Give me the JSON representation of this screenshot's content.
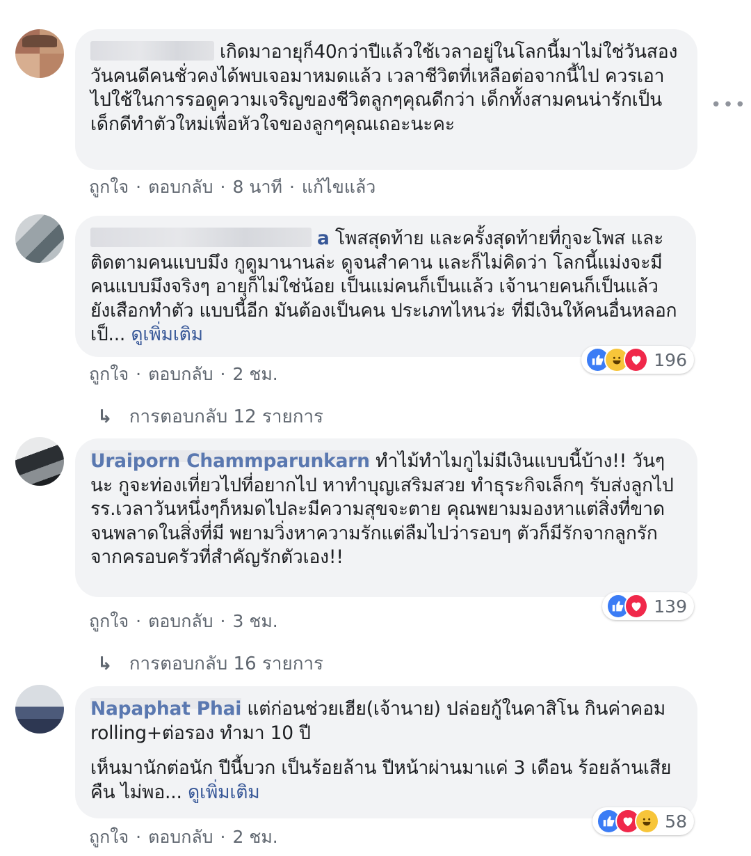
{
  "comments": [
    {
      "name_visible": "",
      "text": "เกิดมาอายุก็40กว่าปีแล้วใช้เวลาอยู่ในโลกนี้มาไม่ใช่วันสองวันคนดีคนชั่วคงได้พบเจอมาหมดแล้ว เวลาชีวิตที่เหลือต่อจากนี้ไป ควรเอาไปใช้ในการรอดูความเจริญของชีวิตลูกๆคุณดีกว่า เด็กทั้งสามคนน่ารักเป็นเด็กดีทำตัวใหม่เพื่อหัวใจของลูกๆคุณเถอะนะคะ",
      "actions": {
        "like": "ถูกใจ",
        "reply": "ตอบกลับ",
        "time": "8 นาที",
        "edited": "แก้ไขแล้ว"
      }
    },
    {
      "name_visible": "a",
      "text": "โพสสุดท้าย และครั้งสุดท้ายที่กูจะโพส และติดตามคนแบบมึง กูดูมานานล่ะ ดูจนสำคาน และก็ไม่คิดว่า โลกนี้แม่งจะมีคนแบบมึงจริงๆ อายุก็ไม่ใช่น้อย เป็นแม่คนก็เป็นแล้ว เจ้านายคนก็เป็นแล้ว ยังเสือกทำตัว แบบนี้อีก มันต้องเป็นคน ประเภทไหนว่ะ ที่มีเงินให้คนอื่นหลอกเป็...",
      "see_more": "ดูเพิ่มเติม",
      "reaction_count": "196",
      "actions": {
        "like": "ถูกใจ",
        "reply": "ตอบกลับ",
        "time": "2 ชม."
      },
      "replies": "การตอบกลับ 12 รายการ"
    },
    {
      "name_visible": "Uraiporn Chammparunkarn",
      "text": "ทำไม้ทำไมกูไม่มีเงินแบบนี้บ้าง!! วันๆนะ กูจะท่องเที่ยวไปที่อยากไป หาทำบุญเสริมสวย ทำธุระกิจเล็กๆ รับส่งลูกไป รร.เวลาวันหนึ่งๆก็หมดไปละมีความสุขจะตาย คุณพยามมองหาแต่สิ่งที่ขาดจนพลาดในสิ่งที่มี พยามวิ่งหาความรักแต่ลืมไปว่ารอบๆ ตัวก็มีรักจากลูกรักจากครอบครัวที่สำคัญรักตัวเอง!!",
      "reaction_count": "139",
      "actions": {
        "like": "ถูกใจ",
        "reply": "ตอบกลับ",
        "time": "3 ชม."
      },
      "replies": "การตอบกลับ 16 รายการ"
    },
    {
      "name_visible": "Napaphat Phai",
      "text": "แต่ก่อนช่วยเฮีย(เจ้านาย) ปล่อยกู้ในคาสิโน กินค่าคอม rolling+ต่อรอง ทำมา 10 ปี",
      "text2": "เห็นมานักต่อนัก ปีนี้บวก เป็นร้อยล้าน ปีหน้าผ่านมาแค่ 3 เดือน ร้อยล้านเสียคืน ไม่พอ...",
      "see_more": "ดูเพิ่มเติม",
      "reaction_count": "58",
      "actions": {
        "like": "ถูกใจ",
        "reply": "ตอบกลับ",
        "time": "2 ชม."
      }
    }
  ],
  "menu_icon": "more-horizontal-icon",
  "colors": {
    "bubble": "#f2f3f5",
    "link": "#385898",
    "meta": "#606770",
    "like": "#3b7cf5",
    "love": "#f0284a",
    "haha": "#f7c53a"
  }
}
